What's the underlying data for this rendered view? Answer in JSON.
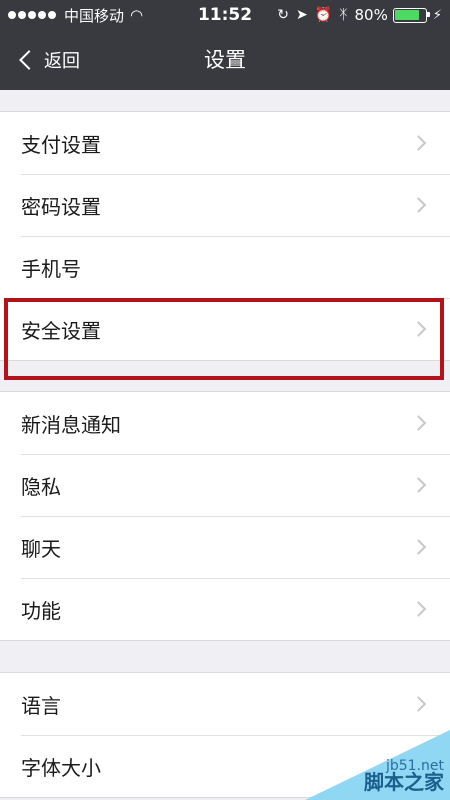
{
  "statusbar": {
    "carrier": "中国移动",
    "time": "11:52",
    "battery_percent": "80%",
    "battery_level": 0.8
  },
  "navbar": {
    "back_label": "返回",
    "title": "设置"
  },
  "groups": [
    {
      "items": [
        "支付设置",
        "密码设置",
        "手机号",
        "安全设置"
      ]
    },
    {
      "items": [
        "新消息通知",
        "隐私",
        "聊天",
        "功能"
      ]
    },
    {
      "items": [
        "语言",
        "字体大小"
      ]
    }
  ],
  "highlight": {
    "target": "安全设置",
    "color": "#b3141b"
  },
  "watermark": {
    "url": "jb51.net",
    "name": "脚本之家"
  },
  "colors": {
    "navbar": "#393a3f",
    "background": "#efeff4",
    "battery": "#4cd964"
  }
}
